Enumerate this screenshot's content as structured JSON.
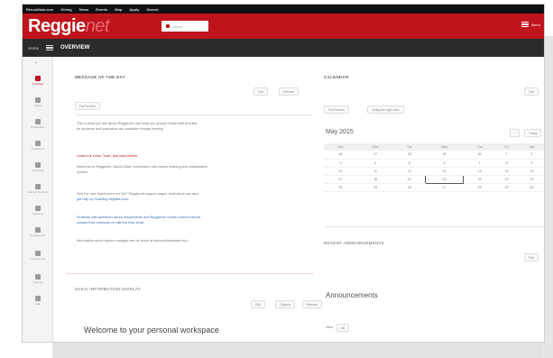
{
  "topbar": {
    "links": [
      "ReconData.com",
      "Giving",
      "News",
      "Events",
      "Map",
      "Apply",
      "Search"
    ]
  },
  "header": {
    "logo_main": "Reggie",
    "logo_net": "net",
    "home_button": "Home",
    "menu_label": "Menu"
  },
  "navbar": {
    "home": "Home",
    "title": "OVERVIEW"
  },
  "sidebar": {
    "collapse": "‹",
    "items": [
      {
        "label": "Overview"
      },
      {
        "label": "Profile"
      },
      {
        "label": "Registration"
      },
      {
        "label": "Academics"
      },
      {
        "label": "Financials"
      },
      {
        "label": "Student Services"
      },
      {
        "label": "Housing"
      },
      {
        "label": "Employment"
      },
      {
        "label": "Campus Life"
      },
      {
        "label": "Settings"
      },
      {
        "label": "Help"
      }
    ]
  },
  "motd": {
    "title": "MESSAGE OF THE DAY",
    "pill1": "Full Screen",
    "btn_a": "Edit",
    "btn_b": "Refresh",
    "lines": [
      "This is what you like about Reggienet; see what you should create with tutorials",
      "for students and instructors are available through iweekly.",
      "Under the Lines: Tools, and Instruments.",
      "Welcome to Reggienet, Illinois State University's web-based learning and collaboration",
      "system.",
      "Visit the new Sakai home for 24/7 Reggienet support pages. Instructors can also",
      "get help by emailing ctt@ilstu.edu.",
      "Students with questions about assignments and Reggienet course content should",
      "contact their instructor or visit the Help Desk.",
      "Information about system outages can be found at status.illinoisstate.edu."
    ]
  },
  "workspace": {
    "label": "SAKAI INFORMATION DISPLAY",
    "btn_a": "Edit",
    "btn_b": "Options",
    "btn_c": "Refresh",
    "welcome": "Welcome to your personal workspace"
  },
  "calendar": {
    "title": "CALENDAR",
    "pill": "Full Screen",
    "pill2": "Today the right view",
    "btn": "Edit",
    "month": "May 2015",
    "prev": "‹",
    "today": "Today",
    "headers": [
      "Sun",
      "Mon",
      "Tue",
      "Wed",
      "Thu",
      "Fri",
      "Sat"
    ],
    "weeks": [
      [
        "26",
        "27",
        "28",
        "29",
        "30",
        "1",
        "2"
      ],
      [
        "3",
        "4",
        "5",
        "6",
        "7",
        "8",
        "9"
      ],
      [
        "10",
        "11",
        "12",
        "13",
        "14",
        "15",
        "16"
      ],
      [
        "17",
        "18",
        "19",
        "20",
        "21",
        "22",
        "23"
      ],
      [
        "24",
        "25",
        "26",
        "27",
        "28",
        "29",
        "30"
      ]
    ]
  },
  "recent": {
    "label": "RECENT ANNOUNCEMENTS",
    "btn": "Edit",
    "title": "Announcements",
    "view_label": "View",
    "view_value": "All"
  }
}
